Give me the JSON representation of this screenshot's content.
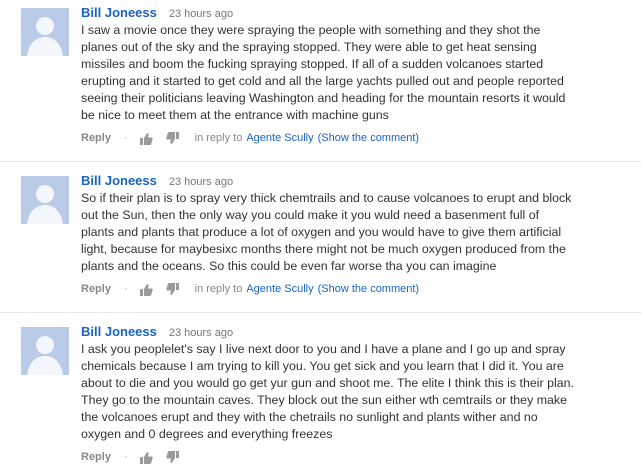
{
  "comments": [
    {
      "author": "Bill Joneess",
      "time": "23 hours ago",
      "text": "I saw a movie once they were spraying the people with something and they shot the\nplanes out of the sky and the spraying stopped. They were able to get heat sensing\nmissiles and boom the fucking spraying stopped. If all of a sudden volcanoes started\nerupting and it started to get cold and all the large yachts pulled out and people reported\nseeing their politicians leaving Washington and heading for the mountain resorts it would\nbe nice to meet them at the entrance with machine guns",
      "reply_label": "Reply",
      "dot": "·",
      "in_reply_label": "in reply to",
      "in_reply_name": "Agente Scully",
      "show_comment": "(Show the comment)"
    },
    {
      "author": "Bill Joneess",
      "time": "23 hours ago",
      "text": "So if their plan is to spray very thick chemtrails and to cause volcanoes to erupt and block\nout the Sun, then the only way you could make it you wuld need a basenment full of\nplants and plants that produce a lot of oxygen and you would have to give them artificial\nlight, because for maybesixc months there might not be much oxygen produced from the\nplants and the oceans. So this could be even far worse tha you can imagine",
      "reply_label": "Reply",
      "dot": "·",
      "in_reply_label": "in reply to",
      "in_reply_name": "Agente Scully",
      "show_comment": "(Show the comment)"
    },
    {
      "author": "Bill Joneess",
      "time": "23 hours ago",
      "text": "I ask you peoplelet's say I live next door to you and I have a plane and I go up and spray\nchemicals because I am trying to kill you. You get sick and you learn that I did it. You are\nabout to die and you would go get yur gun and shoot me. The elite I think this is their plan.\nThey go to the mountain caves. They block out the sun either wth cemtrails or they make\nthe volcanoes erupt and they with the chetrails no sunlight and plants wither and no\noxygen and 0 degrees and everything freezes",
      "reply_label": "Reply",
      "dot": "·"
    }
  ],
  "icons": {
    "avatar": "default-user-avatar-icon",
    "thumb_up": "thumbs-up-icon",
    "thumb_down": "thumbs-down-icon"
  },
  "colors": {
    "link": "#1a63c4",
    "avatar_bg": "#b9cbe6",
    "avatar_figure": "#f3f6fb",
    "text": "#333333",
    "muted": "#888888",
    "icon": "#9a9a9a"
  }
}
